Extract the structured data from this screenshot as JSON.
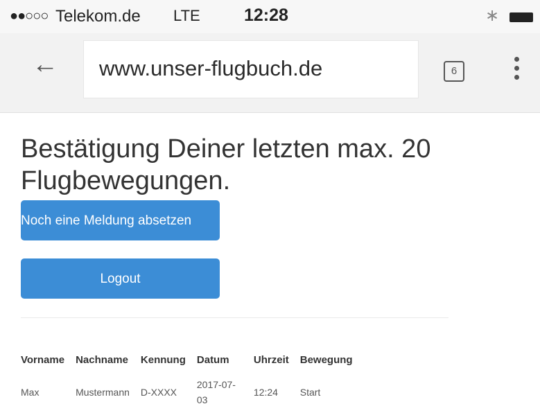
{
  "status_bar": {
    "signal": "●●○○○",
    "carrier": "Telekom.de",
    "network": "LTE",
    "time": "12:28",
    "bluetooth_icon": "bluetooth-icon",
    "battery_icon": "battery-icon"
  },
  "browser": {
    "url": "www.unser-flugbuch.de",
    "tab_count": "6",
    "back_icon": "back-arrow-icon",
    "menu_icon": "overflow-menu-icon"
  },
  "page": {
    "heading": "Bestätigung Deiner letzten max. 20 Flugbewegungen.",
    "buttons": {
      "new_report": "Noch eine Meldung absetzen",
      "logout": "Logout"
    },
    "table": {
      "headers": [
        "Vorname",
        "Nachname",
        "Kennung",
        "Datum",
        "Uhrzeit",
        "Bewegung"
      ],
      "rows": [
        [
          "Max",
          "Mustermann",
          "D-XXXX",
          "2017-07-03",
          "12:24",
          "Start"
        ]
      ]
    },
    "colors": {
      "button": "#3c8dd6",
      "text": "#333333"
    }
  }
}
